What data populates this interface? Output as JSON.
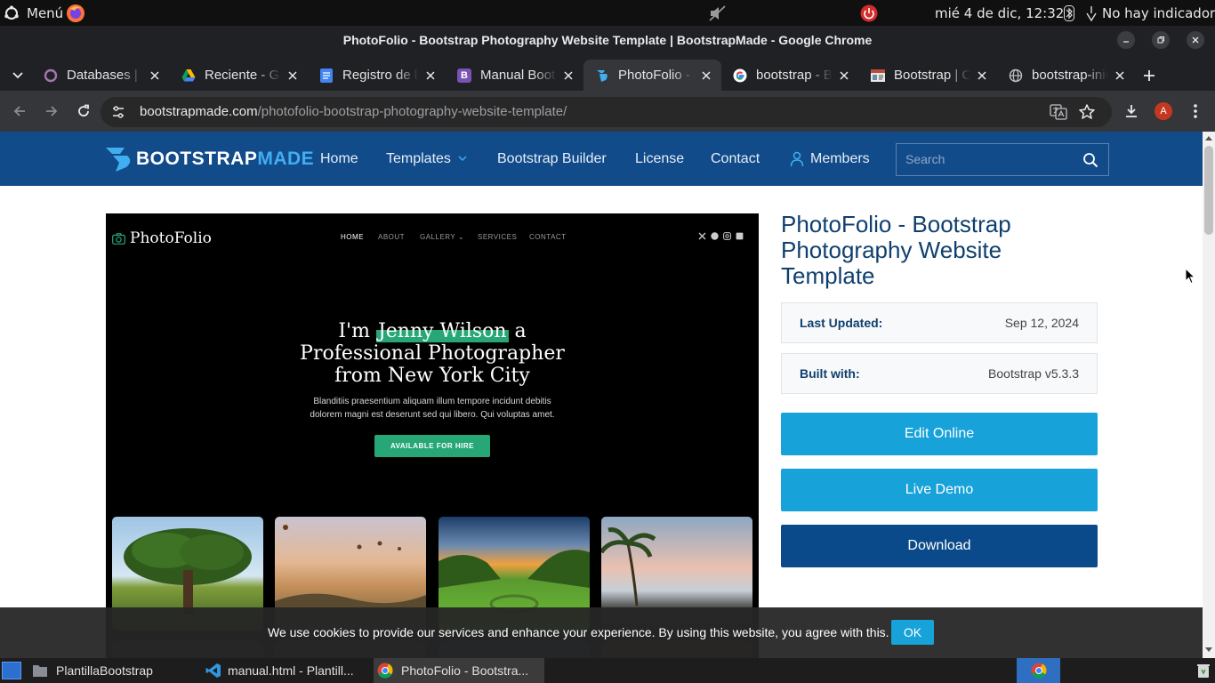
{
  "os": {
    "menu_label": "Menú",
    "clock": "mié  4 de dic, 12:32",
    "indicators": "No hay indicadores"
  },
  "window": {
    "title": "PhotoFolio - Bootstrap Photography Website Template | BootstrapMade - Google Chrome"
  },
  "tabs": [
    {
      "label": "Databases | Cl",
      "icon": "databases-favicon",
      "active": false
    },
    {
      "label": "Reciente - Goo",
      "icon": "google-drive-favicon",
      "active": false
    },
    {
      "label": "Registro de la",
      "icon": "google-docs-favicon",
      "active": false
    },
    {
      "label": "Manual Bootst",
      "icon": "bootstrap-favicon",
      "active": false
    },
    {
      "label": "PhotoFolio - B",
      "icon": "bootstrapmade-favicon",
      "active": true
    },
    {
      "label": "bootstrap - Bu",
      "icon": "google-favicon",
      "active": false
    },
    {
      "label": "Bootstrap | Co",
      "icon": "website-favicon",
      "active": false
    },
    {
      "label": "bootstrap-inic",
      "icon": "globe-favicon",
      "active": false
    }
  ],
  "address": {
    "domain": "bootstrapmade.com",
    "path": "/photofolio-bootstrap-photography-website-template/",
    "profile_initial": "A"
  },
  "site": {
    "logo_a": "BOOTSTRAP",
    "logo_b": "MADE",
    "nav": {
      "home": "Home",
      "templates": "Templates",
      "builder": "Bootstrap Builder",
      "license": "License",
      "contact": "Contact",
      "members": "Members"
    },
    "search_placeholder": "Search"
  },
  "preview": {
    "brand": "PhotoFolio",
    "nav": [
      "HOME",
      "ABOUT",
      "GALLERY",
      "SERVICES",
      "CONTACT"
    ],
    "hero_pre": "I'm ",
    "hero_name": "Jenny Wilson",
    "hero_post": " a",
    "hero_line2": "Professional Photographer",
    "hero_line3": "from New York City",
    "hero_sub1": "Blanditiis praesentium aliquam illum tempore incidunt debitis",
    "hero_sub2": "dolorem magni est deserunt sed qui libero. Qui voluptas amet.",
    "hire_button": "AVAILABLE FOR HIRE"
  },
  "product": {
    "title": "PhotoFolio - Bootstrap Photography Website Template",
    "last_updated_label": "Last Updated:",
    "last_updated_value": "Sep 12, 2024",
    "built_with_label": "Built with:",
    "built_with_value": "Bootstrap v5.3.3",
    "edit_online": "Edit Online",
    "live_demo": "Live Demo",
    "download": "Download"
  },
  "cookie": {
    "text": "We use cookies to provide our services and enhance your experience. By using this website, you agree with this.",
    "ok": "OK"
  },
  "taskbar": {
    "items": [
      "PlantillaBootstrap",
      "manual.html - Plantill...",
      "PhotoFolio - Bootstra..."
    ]
  },
  "colors": {
    "nav_blue": "#124b8a",
    "button_cyan": "#17a2d9",
    "button_dark": "#0b4a8a",
    "accent_green": "#27a776"
  }
}
